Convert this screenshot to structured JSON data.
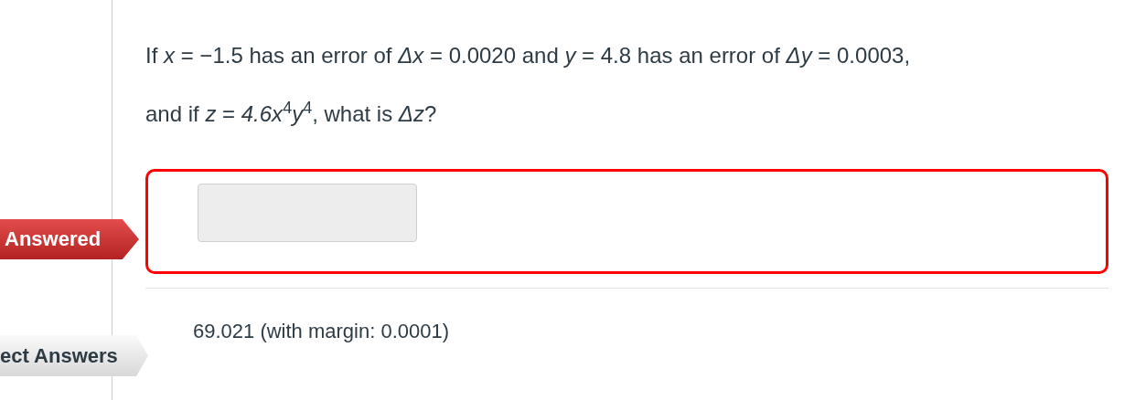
{
  "question": {
    "paragraphs": [
      "If *x* = −1.5 has an error of *Δx* = 0.0020 and *y* = 4.8 has an error of *Δy* = 0.0003,",
      "and if *z* = *4.6x*$^{4}$*y*$^{4}$, what is *Δz*?"
    ]
  },
  "answer": {
    "status_tag": "Answered"
  },
  "correct_answers": {
    "label": "ect Answers",
    "answers": [
      "69.021 (with margin: 0.0001)"
    ]
  }
}
